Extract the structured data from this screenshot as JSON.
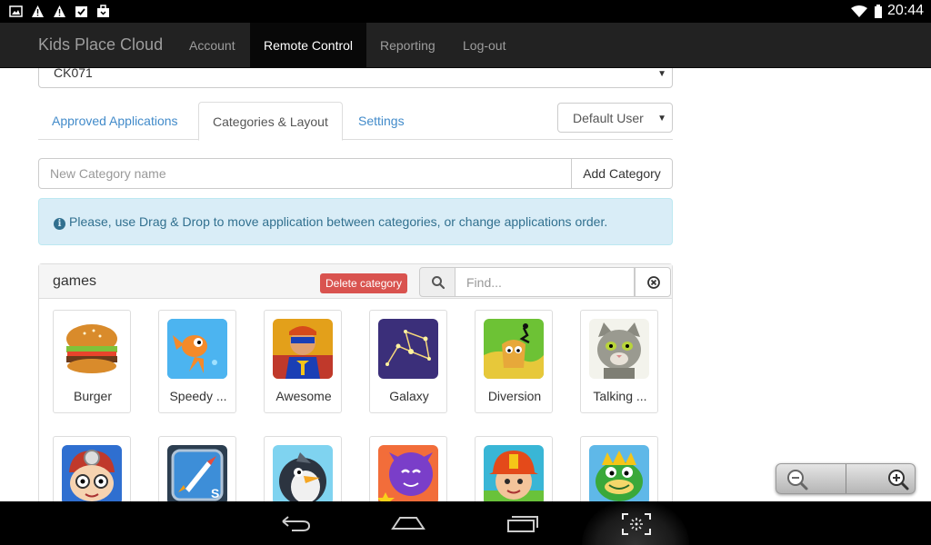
{
  "status_bar": {
    "time": "20:44",
    "icons": [
      "image-icon",
      "warning-icon",
      "warning-icon",
      "checkbox-icon",
      "briefcase-icon",
      "wifi-icon",
      "battery-icon"
    ]
  },
  "navbar": {
    "brand": "Kids Place Cloud",
    "items": [
      {
        "label": "Account",
        "active": false
      },
      {
        "label": "Remote Control",
        "active": true
      },
      {
        "label": "Reporting",
        "active": false
      },
      {
        "label": "Log-out",
        "active": false
      }
    ]
  },
  "device_select": {
    "value": "CK071"
  },
  "tabs": [
    {
      "label": "Approved Applications",
      "active": false
    },
    {
      "label": "Categories & Layout",
      "active": true
    },
    {
      "label": "Settings",
      "active": false
    }
  ],
  "user_select": {
    "value": "Default User"
  },
  "new_category": {
    "placeholder": "New Category name",
    "button": "Add Category"
  },
  "alert": {
    "text": "Please, use Drag & Drop to move application between categories, or change applications order."
  },
  "panel": {
    "title": "games",
    "delete_button": "Delete category",
    "find_placeholder": "Find...",
    "apps_row1": [
      {
        "name": "Burger",
        "icon": "burger-app-icon"
      },
      {
        "name": "Speedy ...",
        "icon": "speedy-app-icon"
      },
      {
        "name": "Awesome",
        "icon": "awesome-app-icon"
      },
      {
        "name": "Galaxy",
        "icon": "galaxy-app-icon"
      },
      {
        "name": "Diversion",
        "icon": "diversion-app-icon"
      },
      {
        "name": "Talking ...",
        "icon": "talking-app-icon"
      }
    ],
    "apps_row2": [
      {
        "name": "",
        "icon": "doctor-kid-app-icon"
      },
      {
        "name": "",
        "icon": "rocket-app-icon"
      },
      {
        "name": "",
        "icon": "penguin-app-icon"
      },
      {
        "name": "",
        "icon": "purple-monster-app-icon"
      },
      {
        "name": "",
        "icon": "firefighter-app-icon"
      },
      {
        "name": "",
        "icon": "dragon-app-icon"
      }
    ]
  },
  "colors": {
    "navbar": "#222222",
    "link": "#428bca",
    "alert_bg": "#d9edf7",
    "alert_text": "#31708f",
    "danger": "#d9534f"
  }
}
